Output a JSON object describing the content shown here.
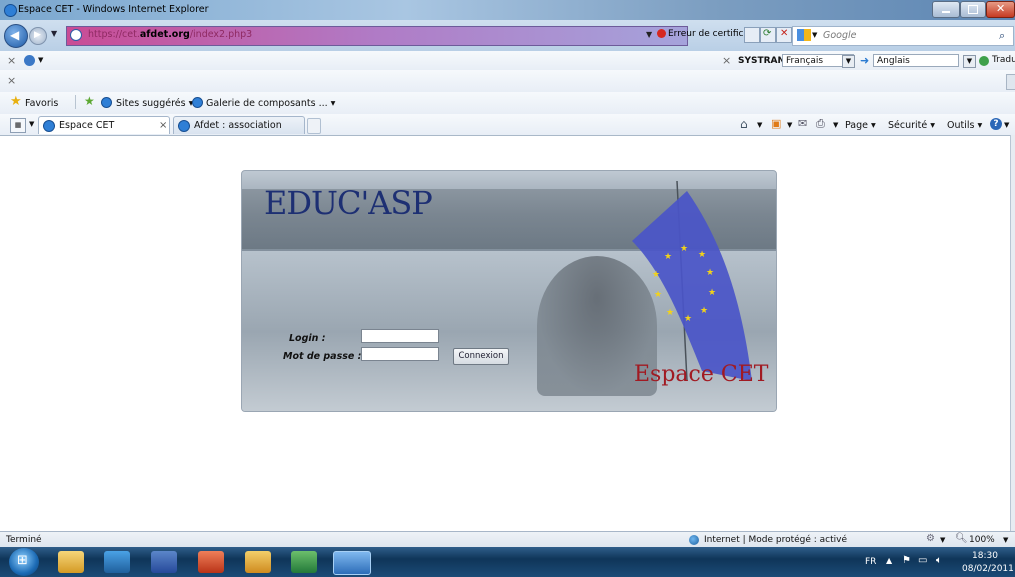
{
  "window": {
    "title": "Espace CET - Windows Internet Explorer"
  },
  "address_bar": {
    "url_prefix": "https://cet.",
    "url_domain": "afdet.org",
    "url_path": "/index2.php3",
    "cert_error": "Erreur de certificat",
    "search_placeholder": "Google"
  },
  "translate_bar": {
    "brand": "SYSTRAN",
    "from_lang": "Français",
    "to_lang": "Anglais",
    "translate_label": "Traduire"
  },
  "favorites_bar": {
    "favorites_label": "Favoris",
    "suggested_label": "Sites suggérés",
    "gallery_label": "Galerie de composants ..."
  },
  "tabs": [
    {
      "label": "Espace CET",
      "active": true
    },
    {
      "label": "Afdet : association français...",
      "active": false
    }
  ],
  "command_bar": {
    "page_label": "Page",
    "security_label": "Sécurité",
    "tools_label": "Outils"
  },
  "login_panel": {
    "brand_title": "EDUC'ASP",
    "brand_subtitle": "Espace CET",
    "login_label": "Login :",
    "password_label": "Mot de passe :",
    "login_value": "",
    "password_value": "",
    "connect_button": "Connexion"
  },
  "status_bar": {
    "status_text": "Terminé",
    "zone_text": "Internet | Mode protégé : activé",
    "zoom": "100%"
  },
  "taskbar": {
    "language": "FR",
    "time": "18:30",
    "date": "08/02/2011"
  },
  "colors": {
    "brand_blue": "#1d2f73",
    "brand_red": "#a11a22",
    "address_gradient_start": "#c94c95"
  }
}
